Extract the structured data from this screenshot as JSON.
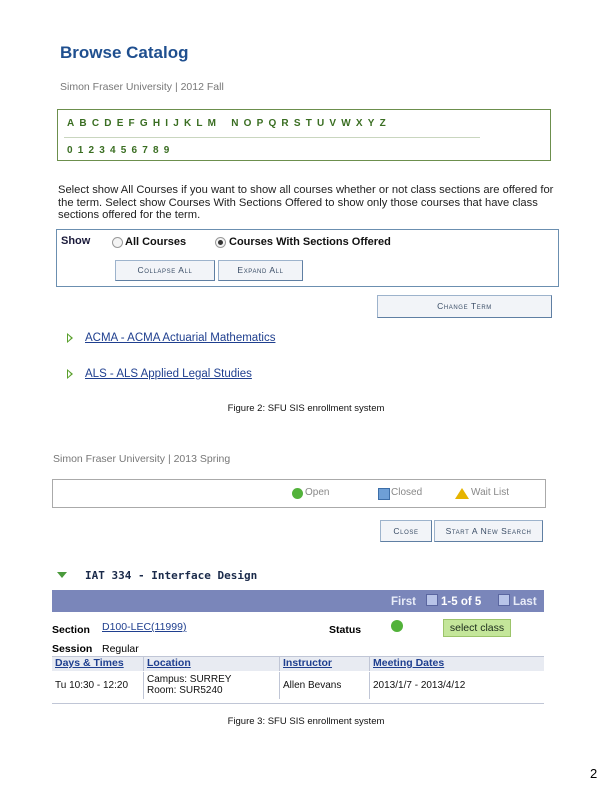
{
  "catalog": {
    "title": "Browse Catalog",
    "subtitle": "Simon Fraser University | 2012 Fall",
    "letters": [
      "A",
      "B",
      "C",
      "D",
      "E",
      "F",
      "G",
      "H",
      "I",
      "J",
      "K",
      "L",
      "M",
      "N",
      "O",
      "P",
      "Q",
      "R",
      "S",
      "T",
      "U",
      "V",
      "W",
      "X",
      "Y",
      "Z"
    ],
    "digits": [
      "0",
      "1",
      "2",
      "3",
      "4",
      "5",
      "6",
      "7",
      "8",
      "9"
    ],
    "instructions": "Select show All Courses if you want to show all courses whether or not class sections are offered for the term. Select show Courses With Sections Offered to show only those courses that have class sections offered for the term.",
    "show_label": "Show",
    "option_all": "All Courses",
    "option_offered": "Courses With Sections Offered",
    "selected_option": "Courses With Sections Offered",
    "collapse_all": "Collapse All",
    "expand_all": "Expand All",
    "change_term": "Change Term",
    "subjects": [
      {
        "label": "ACMA - ACMA Actuarial Mathematics"
      },
      {
        "label": "ALS - ALS Applied Legal Studies"
      }
    ]
  },
  "caption1": "Figure 2: SFU SIS enrollment system",
  "results": {
    "subtitle": "Simon Fraser University | 2013 Spring",
    "legend": {
      "open": "Open",
      "closed": "Closed",
      "wait": "Wait List"
    },
    "close": "Close",
    "new_search": "Start A New Search",
    "course": "IAT 334 - Interface Design",
    "nav": {
      "first": "First",
      "range": "1-5 of 5",
      "last": "Last"
    },
    "section_label": "Section",
    "section_value": "D100-LEC(11999)",
    "status_label": "Status",
    "select_class": "select class",
    "session_label": "Session",
    "session_value": "Regular",
    "columns": [
      "Days & Times",
      "Location",
      "Instructor",
      "Meeting Dates"
    ],
    "row": {
      "days_times": "Tu 10:30 - 12:20",
      "campus": "Campus: SURREY",
      "room": "Room: SUR5240",
      "instructor": "Allen Bevans",
      "dates": "2013/1/7 - 2013/4/12"
    }
  },
  "caption2": "Figure 3: SFU SIS enrollment system",
  "page_number": "2",
  "colors": {
    "accent": "#1f4f8f",
    "letters": "#3a6e22",
    "nav_bar": "#7a86ba",
    "open": "#52b23a",
    "closed": "#6e9fd6",
    "wait": "#e6b400"
  }
}
